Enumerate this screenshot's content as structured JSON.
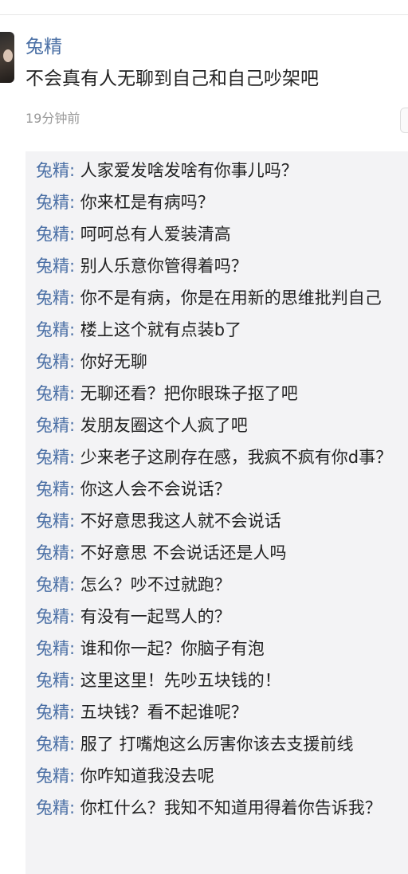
{
  "post": {
    "username": "兔精",
    "text": "不会真有人无聊到自己和自己吵架吧",
    "time": "19分钟前"
  },
  "comments": [
    {
      "user": "兔精",
      "text": "人家爱发啥发啥有你事儿吗？"
    },
    {
      "user": "兔精",
      "text": "你来杠是有病吗？"
    },
    {
      "user": "兔精",
      "text": "呵呵总有人爱装清高"
    },
    {
      "user": "兔精",
      "text": "别人乐意你管得着吗？"
    },
    {
      "user": "兔精",
      "text": "你不是有病，你是在用新的思维批判自己"
    },
    {
      "user": "兔精",
      "text": "楼上这个就有点装b了"
    },
    {
      "user": "兔精",
      "text": "你好无聊"
    },
    {
      "user": "兔精",
      "text": "无聊还看？把你眼珠子抠了吧"
    },
    {
      "user": "兔精",
      "text": "发朋友圈这个人疯了吧"
    },
    {
      "user": "兔精",
      "text": "少来老子这刷存在感，我疯不疯有你d事？"
    },
    {
      "user": "兔精",
      "text": "你这人会不会说话？"
    },
    {
      "user": "兔精",
      "text": "不好意思我这人就不会说话"
    },
    {
      "user": "兔精",
      "text": "不好意思 不会说话还是人吗"
    },
    {
      "user": "兔精",
      "text": "怎么？吵不过就跑？"
    },
    {
      "user": "兔精",
      "text": "有没有一起骂人的？"
    },
    {
      "user": "兔精",
      "text": "谁和你一起？你脑子有泡"
    },
    {
      "user": "兔精",
      "text": "这里这里！先吵五块钱的！"
    },
    {
      "user": "兔精",
      "text": "五块钱？看不起谁呢？"
    },
    {
      "user": "兔精",
      "text": "服了 打嘴炮这么厉害你该去支援前线"
    },
    {
      "user": "兔精",
      "text": "你咋知道我没去呢"
    },
    {
      "user": "兔精",
      "text": "你杠什么？我知不知道用得着你告诉我？"
    }
  ]
}
